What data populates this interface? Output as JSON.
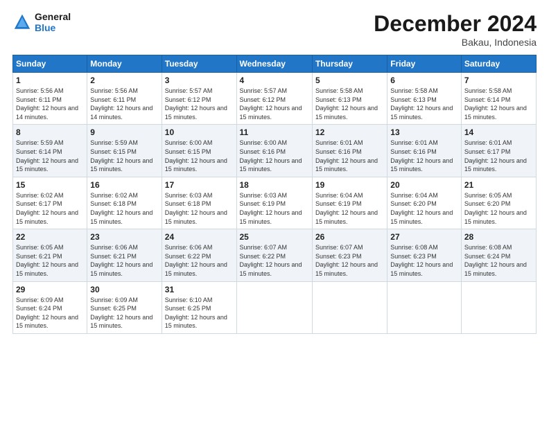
{
  "logo": {
    "line1": "General",
    "line2": "Blue"
  },
  "title": "December 2024",
  "subtitle": "Bakau, Indonesia",
  "days_of_week": [
    "Sunday",
    "Monday",
    "Tuesday",
    "Wednesday",
    "Thursday",
    "Friday",
    "Saturday"
  ],
  "weeks": [
    [
      {
        "day": "1",
        "sunrise": "5:56 AM",
        "sunset": "6:11 PM",
        "daylight": "12 hours and 14 minutes."
      },
      {
        "day": "2",
        "sunrise": "5:56 AM",
        "sunset": "6:11 PM",
        "daylight": "12 hours and 14 minutes."
      },
      {
        "day": "3",
        "sunrise": "5:57 AM",
        "sunset": "6:12 PM",
        "daylight": "12 hours and 15 minutes."
      },
      {
        "day": "4",
        "sunrise": "5:57 AM",
        "sunset": "6:12 PM",
        "daylight": "12 hours and 15 minutes."
      },
      {
        "day": "5",
        "sunrise": "5:58 AM",
        "sunset": "6:13 PM",
        "daylight": "12 hours and 15 minutes."
      },
      {
        "day": "6",
        "sunrise": "5:58 AM",
        "sunset": "6:13 PM",
        "daylight": "12 hours and 15 minutes."
      },
      {
        "day": "7",
        "sunrise": "5:58 AM",
        "sunset": "6:14 PM",
        "daylight": "12 hours and 15 minutes."
      }
    ],
    [
      {
        "day": "8",
        "sunrise": "5:59 AM",
        "sunset": "6:14 PM",
        "daylight": "12 hours and 15 minutes."
      },
      {
        "day": "9",
        "sunrise": "5:59 AM",
        "sunset": "6:15 PM",
        "daylight": "12 hours and 15 minutes."
      },
      {
        "day": "10",
        "sunrise": "6:00 AM",
        "sunset": "6:15 PM",
        "daylight": "12 hours and 15 minutes."
      },
      {
        "day": "11",
        "sunrise": "6:00 AM",
        "sunset": "6:16 PM",
        "daylight": "12 hours and 15 minutes."
      },
      {
        "day": "12",
        "sunrise": "6:01 AM",
        "sunset": "6:16 PM",
        "daylight": "12 hours and 15 minutes."
      },
      {
        "day": "13",
        "sunrise": "6:01 AM",
        "sunset": "6:16 PM",
        "daylight": "12 hours and 15 minutes."
      },
      {
        "day": "14",
        "sunrise": "6:01 AM",
        "sunset": "6:17 PM",
        "daylight": "12 hours and 15 minutes."
      }
    ],
    [
      {
        "day": "15",
        "sunrise": "6:02 AM",
        "sunset": "6:17 PM",
        "daylight": "12 hours and 15 minutes."
      },
      {
        "day": "16",
        "sunrise": "6:02 AM",
        "sunset": "6:18 PM",
        "daylight": "12 hours and 15 minutes."
      },
      {
        "day": "17",
        "sunrise": "6:03 AM",
        "sunset": "6:18 PM",
        "daylight": "12 hours and 15 minutes."
      },
      {
        "day": "18",
        "sunrise": "6:03 AM",
        "sunset": "6:19 PM",
        "daylight": "12 hours and 15 minutes."
      },
      {
        "day": "19",
        "sunrise": "6:04 AM",
        "sunset": "6:19 PM",
        "daylight": "12 hours and 15 minutes."
      },
      {
        "day": "20",
        "sunrise": "6:04 AM",
        "sunset": "6:20 PM",
        "daylight": "12 hours and 15 minutes."
      },
      {
        "day": "21",
        "sunrise": "6:05 AM",
        "sunset": "6:20 PM",
        "daylight": "12 hours and 15 minutes."
      }
    ],
    [
      {
        "day": "22",
        "sunrise": "6:05 AM",
        "sunset": "6:21 PM",
        "daylight": "12 hours and 15 minutes."
      },
      {
        "day": "23",
        "sunrise": "6:06 AM",
        "sunset": "6:21 PM",
        "daylight": "12 hours and 15 minutes."
      },
      {
        "day": "24",
        "sunrise": "6:06 AM",
        "sunset": "6:22 PM",
        "daylight": "12 hours and 15 minutes."
      },
      {
        "day": "25",
        "sunrise": "6:07 AM",
        "sunset": "6:22 PM",
        "daylight": "12 hours and 15 minutes."
      },
      {
        "day": "26",
        "sunrise": "6:07 AM",
        "sunset": "6:23 PM",
        "daylight": "12 hours and 15 minutes."
      },
      {
        "day": "27",
        "sunrise": "6:08 AM",
        "sunset": "6:23 PM",
        "daylight": "12 hours and 15 minutes."
      },
      {
        "day": "28",
        "sunrise": "6:08 AM",
        "sunset": "6:24 PM",
        "daylight": "12 hours and 15 minutes."
      }
    ],
    [
      {
        "day": "29",
        "sunrise": "6:09 AM",
        "sunset": "6:24 PM",
        "daylight": "12 hours and 15 minutes."
      },
      {
        "day": "30",
        "sunrise": "6:09 AM",
        "sunset": "6:25 PM",
        "daylight": "12 hours and 15 minutes."
      },
      {
        "day": "31",
        "sunrise": "6:10 AM",
        "sunset": "6:25 PM",
        "daylight": "12 hours and 15 minutes."
      },
      null,
      null,
      null,
      null
    ]
  ]
}
